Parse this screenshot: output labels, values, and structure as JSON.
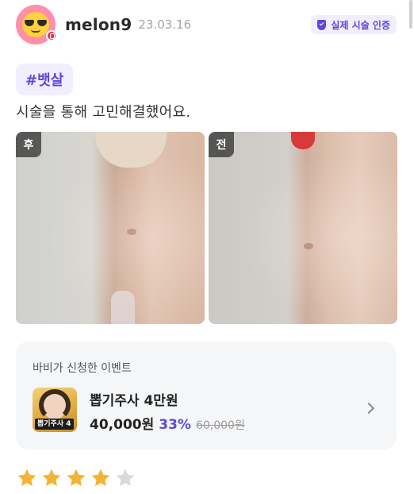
{
  "author": {
    "username": "melon9",
    "date": "23.03.16",
    "verified_label": "실제 시술 인증"
  },
  "hashtag": "#뱃살",
  "review_text": "시술을 통해 고민해결했어요.",
  "photos": [
    {
      "label": "후"
    },
    {
      "label": "전"
    }
  ],
  "event": {
    "title": "바비가 신청한 이벤트",
    "name": "뽑기주사 4만원",
    "price": "40,000원",
    "discount": "33%",
    "original_price": "60,000원",
    "thumbnail_text": "뽑기주사 4"
  },
  "rating": {
    "value": 4,
    "max": 5,
    "filled_color": "#f5b334",
    "empty_color": "#d9d9d9"
  },
  "colors": {
    "accent": "#5b48d6",
    "accent_bg": "#f1efff"
  }
}
